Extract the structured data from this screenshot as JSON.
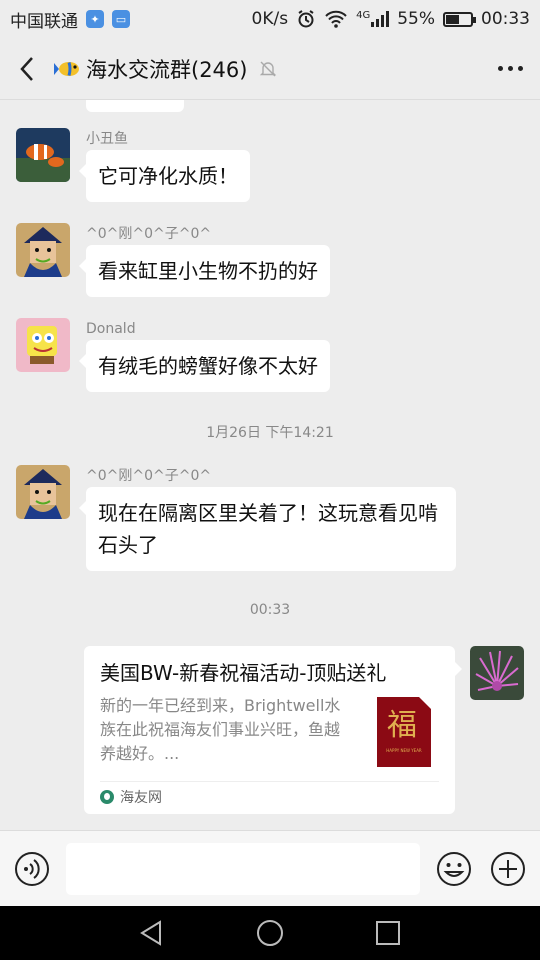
{
  "status_bar": {
    "carrier": "中国联通",
    "speed": "0K/s",
    "network": "4G",
    "battery": "55%",
    "battery_level": 0.55,
    "time": "00:33"
  },
  "header": {
    "title": "海水交流群(246)"
  },
  "messages": [
    {
      "sender": "小丑鱼",
      "text": "它可净化水质！"
    },
    {
      "sender": "^0^刚^0^子^0^",
      "text": "看来缸里小生物不扔的好"
    },
    {
      "sender": "Donald",
      "text": "有绒毛的螃蟹好像不太好"
    },
    {
      "sender": "^0^刚^0^子^0^",
      "text": "现在在隔离区里关着了！这玩意看见啃石头了"
    }
  ],
  "timestamps": [
    "1月26日 下午14:21",
    "00:33"
  ],
  "card": {
    "title": "美国BW-新春祝福活动-顶贴送礼",
    "desc": "新的一年已经到来，Brightwell水族在此祝福海友们事业兴旺，鱼越养越好。...",
    "thumb_char": "福",
    "thumb_caption": "HAPPY NEW YEAR",
    "source": "海友网"
  },
  "input": {
    "value": ""
  },
  "colors": {
    "background": "#ededed",
    "bubble": "#ffffff",
    "card_thumb": "#8b0a14"
  }
}
